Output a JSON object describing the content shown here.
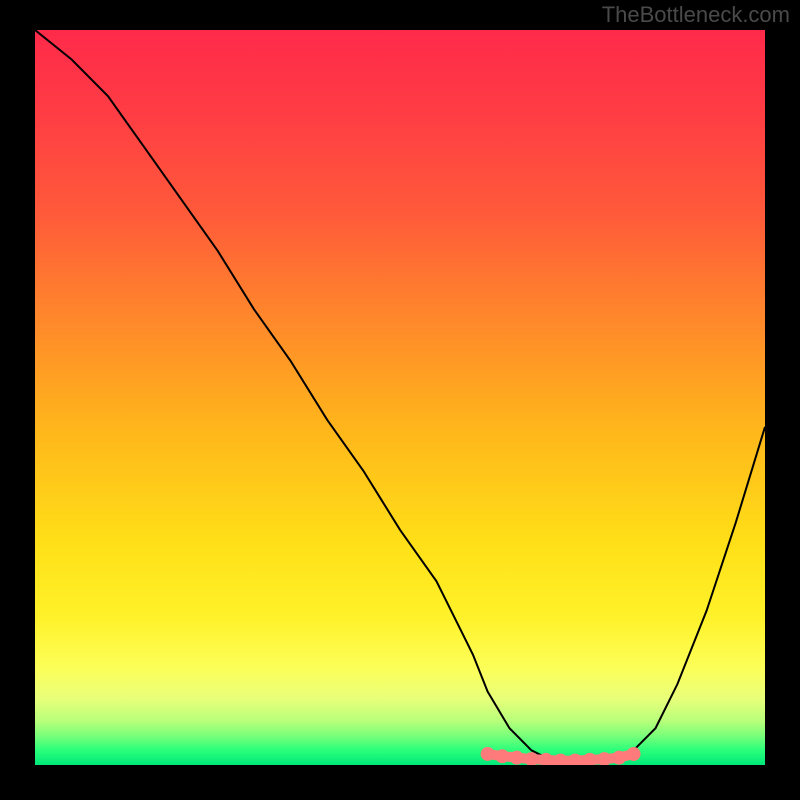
{
  "watermark": "TheBottleneck.com",
  "chart_data": {
    "type": "line",
    "title": "",
    "xlabel": "",
    "ylabel": "",
    "xlim": [
      0,
      100
    ],
    "ylim": [
      0,
      100
    ],
    "grid": false,
    "legend": false,
    "series": [
      {
        "name": "bottleneck-curve",
        "color": "#000000",
        "x": [
          0,
          5,
          10,
          15,
          20,
          25,
          30,
          35,
          40,
          45,
          50,
          55,
          60,
          62,
          65,
          68,
          70,
          72,
          74,
          76,
          78,
          80,
          82,
          85,
          88,
          92,
          96,
          100
        ],
        "y": [
          100,
          96,
          91,
          84,
          77,
          70,
          62,
          55,
          47,
          40,
          32,
          25,
          15,
          10,
          5,
          2,
          1,
          0.5,
          0.3,
          0.3,
          0.5,
          1,
          2,
          5,
          11,
          21,
          33,
          46
        ]
      },
      {
        "name": "optimal-zone-highlight",
        "color": "#ff7a7a",
        "x": [
          62,
          64,
          66,
          68,
          70,
          72,
          74,
          76,
          78,
          80,
          82
        ],
        "y": [
          1.5,
          1.2,
          1.0,
          0.8,
          0.7,
          0.6,
          0.6,
          0.7,
          0.8,
          1.0,
          1.5
        ]
      }
    ],
    "annotations": []
  },
  "colors": {
    "top_red": "#ff2a4a",
    "mid_orange": "#ff8a2a",
    "yellow": "#ffe018",
    "green": "#00e878",
    "curve": "#000000",
    "highlight": "#ff7a7a",
    "frame": "#000000"
  }
}
